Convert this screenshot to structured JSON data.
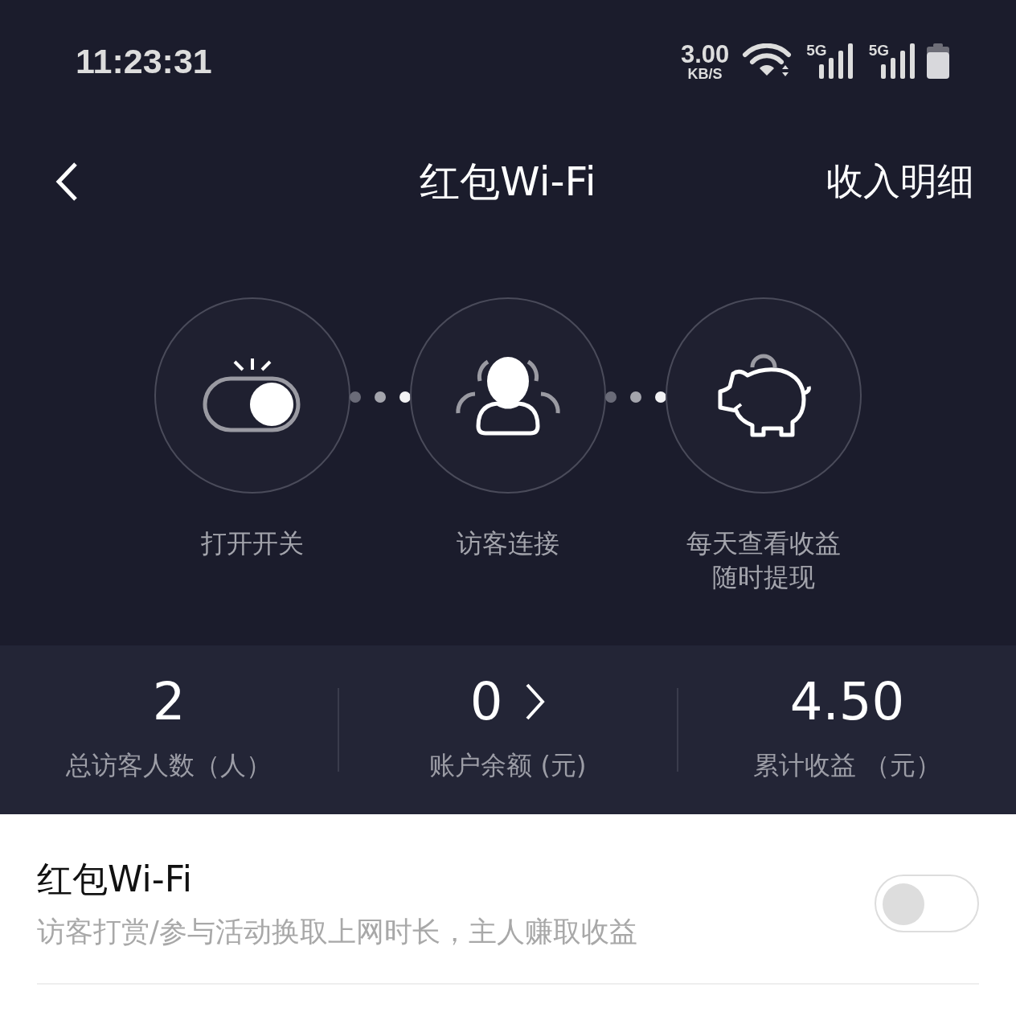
{
  "status_bar": {
    "time": "11:23:31",
    "speed": "3.00",
    "speed_unit": "KB/S",
    "sim_1": "5G",
    "sim_2": "5G"
  },
  "header": {
    "title": "红包Wi-Fi",
    "action": "收入明细"
  },
  "steps": [
    {
      "kind": "switch",
      "lines": [
        "打开开关"
      ]
    },
    {
      "kind": "visitor",
      "lines": [
        "访客连接"
      ]
    },
    {
      "kind": "piggy",
      "lines": [
        "每天查看收益",
        "随时提现"
      ]
    }
  ],
  "stats": [
    {
      "value": "2",
      "label": "总访客人数（人）",
      "link": false
    },
    {
      "value": "0",
      "label": "账户余额 (元)",
      "link": true
    },
    {
      "value": "4.50",
      "label": "累计收益 （元）",
      "link": false
    }
  ],
  "setting": {
    "title": "红包Wi-Fi",
    "description": "访客打赏/参与活动换取上网时长，主人赚取收益",
    "on": false
  }
}
